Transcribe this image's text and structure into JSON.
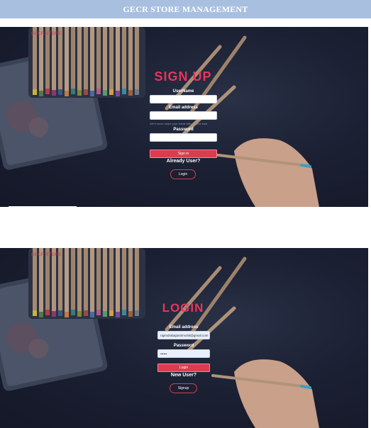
{
  "page": {
    "title": "GECR STORE MANAGEMENT"
  },
  "signup": {
    "brand": "GECR STORE",
    "heading": "SIGN UP",
    "username_label": "UserName",
    "username_value": "",
    "email_label": "Email address",
    "email_value": "",
    "email_hint": "We'll never share your email with anyone else.",
    "password_label": "Password",
    "password_value": "",
    "signin_button": "Sign in",
    "question": "Already User?",
    "login_button": "Login"
  },
  "login": {
    "brand": "GECR STORE",
    "heading": "LOGIN",
    "email_label": "Email address",
    "email_value": "rajendrabajantrimohit@gmail.com",
    "password_label": "Password",
    "password_value": "••••••",
    "login_button": "Login",
    "question": "New User?",
    "signup_button": "Signup"
  },
  "colors": {
    "accent": "#e8345a",
    "button": "#d93d4f",
    "background": "#1b2033",
    "title_bar": "#a8bfe0"
  }
}
